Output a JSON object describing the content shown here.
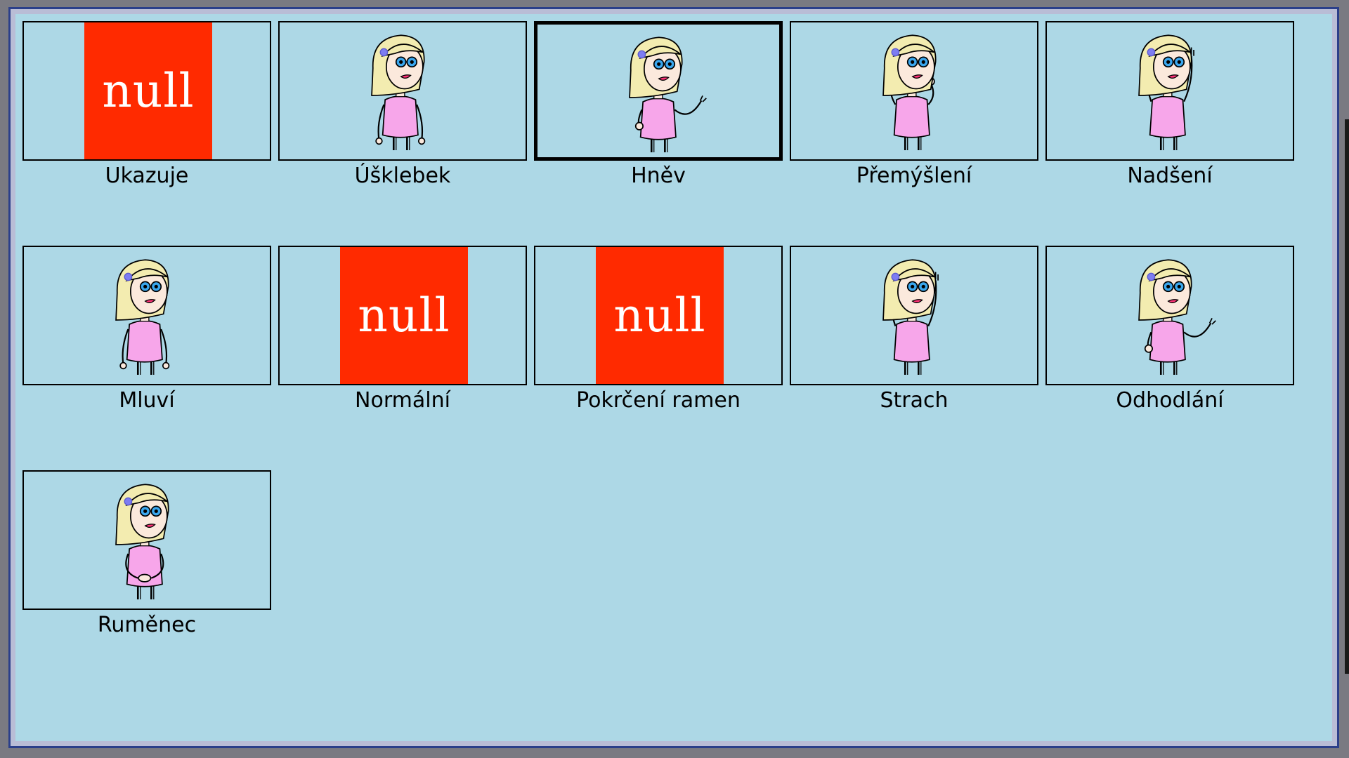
{
  "tiles": [
    {
      "label": "Ukazuje",
      "image": "null",
      "pose": "null"
    },
    {
      "label": "Úšklebek",
      "image": "character",
      "pose": "arms-down"
    },
    {
      "label": "Hněv",
      "image": "character",
      "pose": "angry-fist"
    },
    {
      "label": "Přemýšlení",
      "image": "character",
      "pose": "hands-face"
    },
    {
      "label": "Nadšení",
      "image": "character",
      "pose": "arms-up"
    },
    {
      "label": "Mluví",
      "image": "character",
      "pose": "arms-down"
    },
    {
      "label": "Normální",
      "image": "null",
      "pose": "null"
    },
    {
      "label": "Pokrčení ramen",
      "image": "null",
      "pose": "null"
    },
    {
      "label": "Strach",
      "image": "character",
      "pose": "arms-up"
    },
    {
      "label": "Odhodlání",
      "image": "character",
      "pose": "angry-fist"
    },
    {
      "label": "Ruměnec",
      "image": "character",
      "pose": "hands-clasped"
    }
  ],
  "null_text": "null",
  "selected_label": "Hněv",
  "colors": {
    "background": "#add8e6",
    "null_fill": "#ff2a00",
    "dress": "#f7a6ea",
    "hair": "#f3ecb0",
    "skin": "#fbe9dc",
    "eyes": "#3aa7ee",
    "flower": "#7d7cf2"
  }
}
